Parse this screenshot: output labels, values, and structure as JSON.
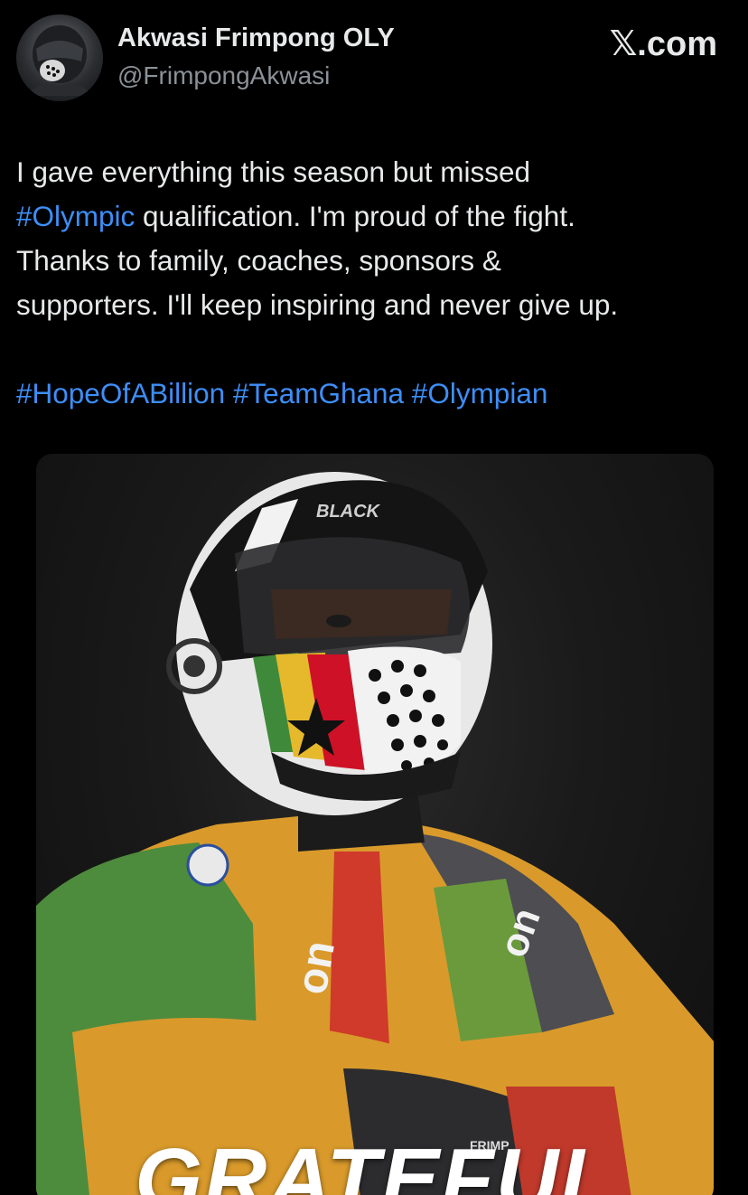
{
  "author": {
    "name": "Akwasi Frimpong OLY",
    "handle": "@FrimpongAkwasi",
    "avatar_icon": "avatar-helmet-icon"
  },
  "brand": {
    "label": "𝕏.com"
  },
  "tweet": {
    "line1": "I gave everything this season but missed",
    "line2_hashtag": "#Olympic",
    "line2_rest": " qualification. I'm proud of the fight.",
    "line3": "Thanks to family, coaches, sponsors &",
    "line4": "supporters. I'll keep inspiring and never give up.",
    "hashtags": [
      "#HopeOfABillion",
      "#TeamGhana",
      "#Olympian"
    ]
  },
  "media": {
    "caption": "GRATEFUL",
    "helmet_text": "BLACK",
    "suit_text": "FRIMP",
    "sponsor_mark": "on"
  },
  "colors": {
    "background": "#000000",
    "text": "#e7e9ea",
    "secondary": "#8b9197",
    "link": "#3e8ef7",
    "ghana_red": "#ce1126",
    "ghana_gold": "#e9a42a",
    "ghana_green": "#3f8a3a"
  }
}
